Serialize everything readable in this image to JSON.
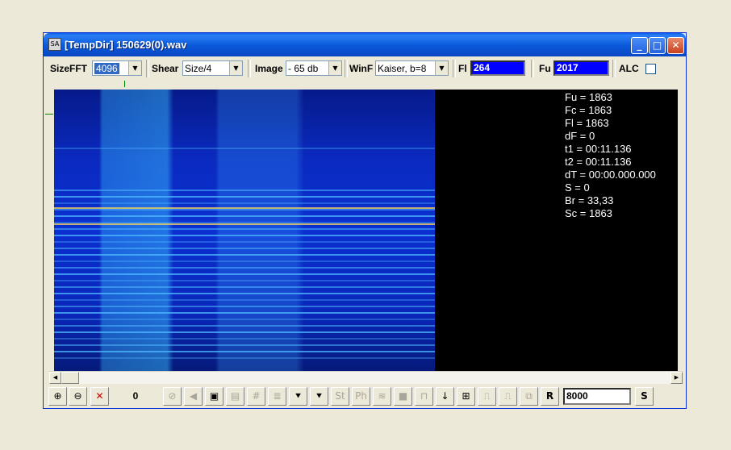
{
  "window": {
    "title": "[TempDir] 150629(0).wav",
    "app_icon_text": "SA"
  },
  "toolbar": {
    "sizefft": {
      "label": "SizeFFT",
      "value": "4096"
    },
    "shear": {
      "label": "Shear",
      "value": "Size/4"
    },
    "image": {
      "label": "Image",
      "value": "- 65 db"
    },
    "winf": {
      "label": "WinF",
      "value": "Kaiser, b=8"
    },
    "fl": {
      "label": "Fl",
      "value": "264"
    },
    "fu": {
      "label": "Fu",
      "value": "2017"
    },
    "alc": {
      "label": "ALC",
      "checked": false
    }
  },
  "readout": [
    "Fu = 1863",
    "Fc = 1863",
    "Fl = 1863",
    "dF = 0",
    "t1 = 00:11.136",
    "t2 = 00:11.136",
    "dT = 00:00.000.000",
    "S = 0",
    "Br = 33,33",
    "Sc = 1863"
  ],
  "bottombar": {
    "counter": "0",
    "st_label": "St",
    "ph_label": "Ph",
    "r_label": "R",
    "rate_value": "8000",
    "s_label": "S"
  },
  "colors": {
    "spectrogram_bg": "#0b2fd0",
    "harmonic_line": "#4fb8ff",
    "hot_line": "#f0d060",
    "field_bg": "#0000ff"
  }
}
